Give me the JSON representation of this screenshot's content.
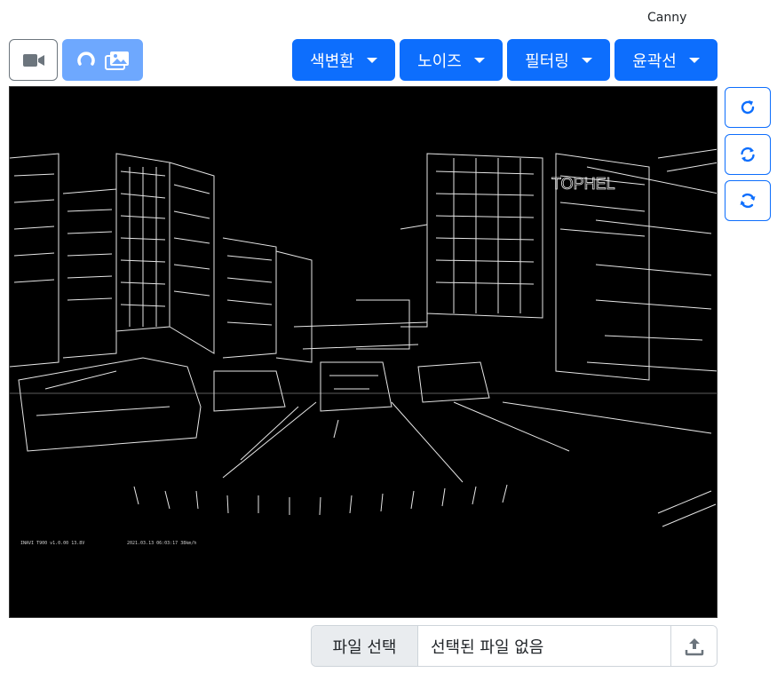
{
  "algorithm_label": "Canny",
  "toolbar": {
    "camera_icon": "video-camera-icon",
    "reset_icon": "arc-spinner-icon",
    "gallery_icon": "images-icon",
    "menus": [
      {
        "label": "색변환"
      },
      {
        "label": "노이즈"
      },
      {
        "label": "필터링"
      },
      {
        "label": "윤곽선"
      }
    ]
  },
  "side_buttons": [
    {
      "icon": "rotate-clockwise-icon"
    },
    {
      "icon": "sync-icon"
    },
    {
      "icon": "arrow-repeat-icon"
    }
  ],
  "viewer": {
    "overlay_text_left": "INAVI T900  v1.0.00  13.8V",
    "overlay_text_mid": "2021.03.13 06:03:17  38km/h",
    "sign_text": "TOPHEL"
  },
  "file_input": {
    "button_label": "파일 선택",
    "status_text": "선택된 파일 없음",
    "upload_icon": "upload-icon"
  },
  "colors": {
    "primary": "#0d6efd",
    "primary_light": "#6ea8fe",
    "outline": "#6c757d"
  }
}
